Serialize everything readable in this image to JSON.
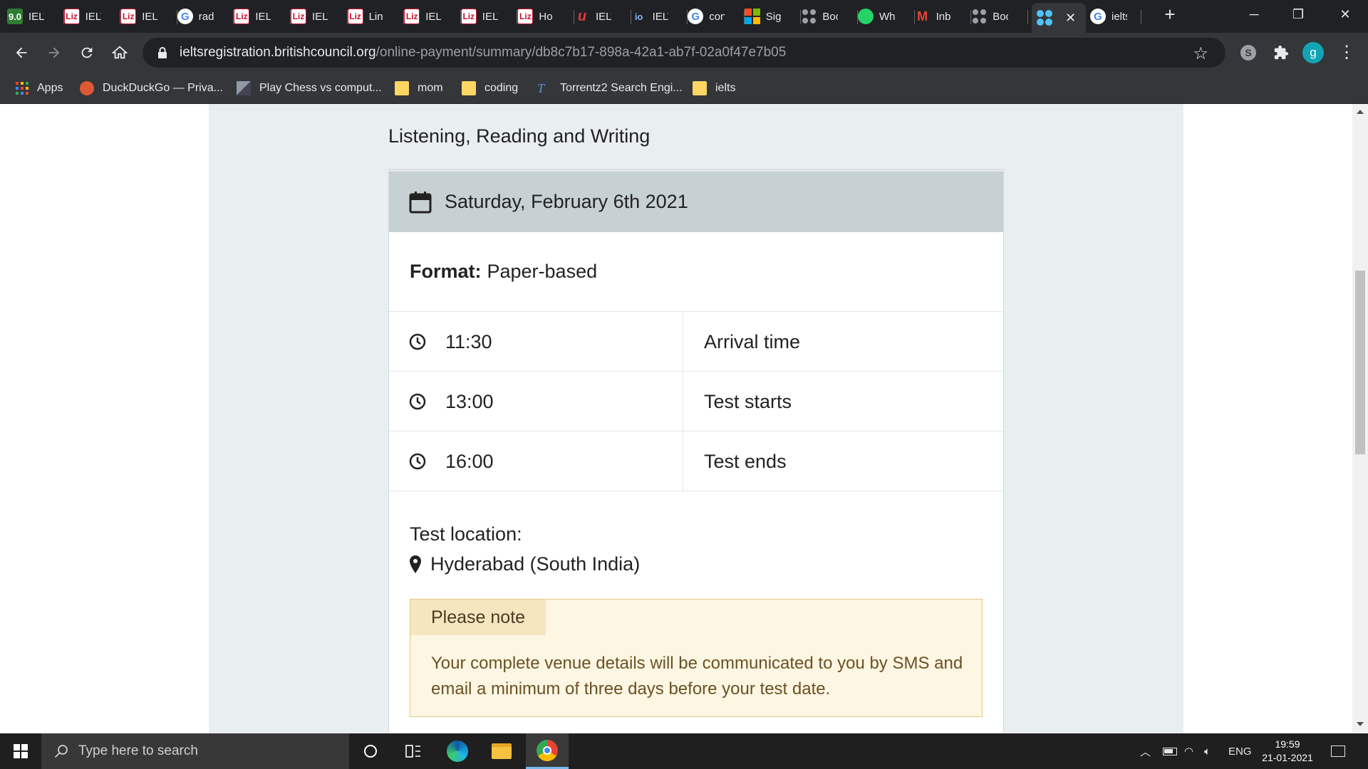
{
  "browser": {
    "tabs": [
      {
        "favicon": "9.0",
        "favicon_type": "nine",
        "label": "IELTS"
      },
      {
        "favicon": "Liz",
        "favicon_type": "liz",
        "label": "IELTS"
      },
      {
        "favicon": "Liz",
        "favicon_type": "liz",
        "label": "IELTS"
      },
      {
        "favicon": "G",
        "favicon_type": "g",
        "label": "rad"
      },
      {
        "favicon": "Liz",
        "favicon_type": "liz",
        "label": "IELTS"
      },
      {
        "favicon": "Liz",
        "favicon_type": "liz",
        "label": "IELTS"
      },
      {
        "favicon": "Liz",
        "favicon_type": "liz",
        "label": "Lin"
      },
      {
        "favicon": "Liz",
        "favicon_type": "liz",
        "label": "IELTS"
      },
      {
        "favicon": "Liz",
        "favicon_type": "liz",
        "label": "IELTS"
      },
      {
        "favicon": "Liz",
        "favicon_type": "liz",
        "label": "Ho"
      },
      {
        "favicon": "u",
        "favicon_type": "u",
        "label": "IELTS"
      },
      {
        "favicon": "io",
        "favicon_type": "io",
        "label": "IELTS"
      },
      {
        "favicon": "G",
        "favicon_type": "g",
        "label": "con"
      },
      {
        "favicon": "",
        "favicon_type": "ms",
        "label": "Sig"
      },
      {
        "favicon": "",
        "favicon_type": "dots",
        "label": "Boo"
      },
      {
        "favicon": "",
        "favicon_type": "wa",
        "label": "Wh"
      },
      {
        "favicon": "M",
        "favicon_type": "gm",
        "label": "Inb"
      },
      {
        "favicon": "",
        "favicon_type": "dots",
        "label": "Boo"
      }
    ],
    "active_tab_close": "✕",
    "last_tab": {
      "favicon": "G",
      "label": "ielts"
    },
    "new_tab": "+",
    "window_controls": {
      "minimize": "─",
      "restore": "❐",
      "close": "✕"
    },
    "url_host": "ieltsregistration.britishcouncil.org",
    "url_path": "/online-payment/summary/db8c7b17-898a-42a1-ab7f-02a0f47e7b05",
    "profile_initial": "g",
    "bookmarks": [
      {
        "label": "Apps",
        "icon": "apps-icon"
      },
      {
        "label": "DuckDuckGo — Priva...",
        "icon": "duckduckgo-icon"
      },
      {
        "label": "Play Chess vs comput...",
        "icon": "chess-icon"
      },
      {
        "label": "mom",
        "icon": "folder-icon"
      },
      {
        "label": "coding",
        "icon": "folder-icon"
      },
      {
        "label": "Torrentz2 Search Engi...",
        "icon": "torrentz-icon"
      },
      {
        "label": "ielts",
        "icon": "folder-icon"
      }
    ]
  },
  "page": {
    "section_title": "Listening, Reading and Writing",
    "date": "Saturday, February 6th 2021",
    "format_label": "Format:",
    "format_value": "Paper-based",
    "schedule": [
      {
        "time": "11:30",
        "label": "Arrival time"
      },
      {
        "time": "13:00",
        "label": "Test starts"
      },
      {
        "time": "16:00",
        "label": "Test ends"
      }
    ],
    "location_label": "Test location:",
    "location": "Hyderabad (South India)",
    "note_title": "Please note",
    "note_body": "Your complete venue details will be communicated to you by SMS and email a minimum of three days before your test date."
  },
  "taskbar": {
    "search_placeholder": "Type here to search",
    "language": "ENG",
    "time": "19:59",
    "date": "21-01-2021"
  },
  "colors": {
    "tabstrip": "#202124",
    "toolbar": "#35363a",
    "date_bar": "#c7d0d3",
    "note_bg": "#fdf6e3",
    "note_border": "#e6c880",
    "page_bg": "#e9eef0"
  }
}
